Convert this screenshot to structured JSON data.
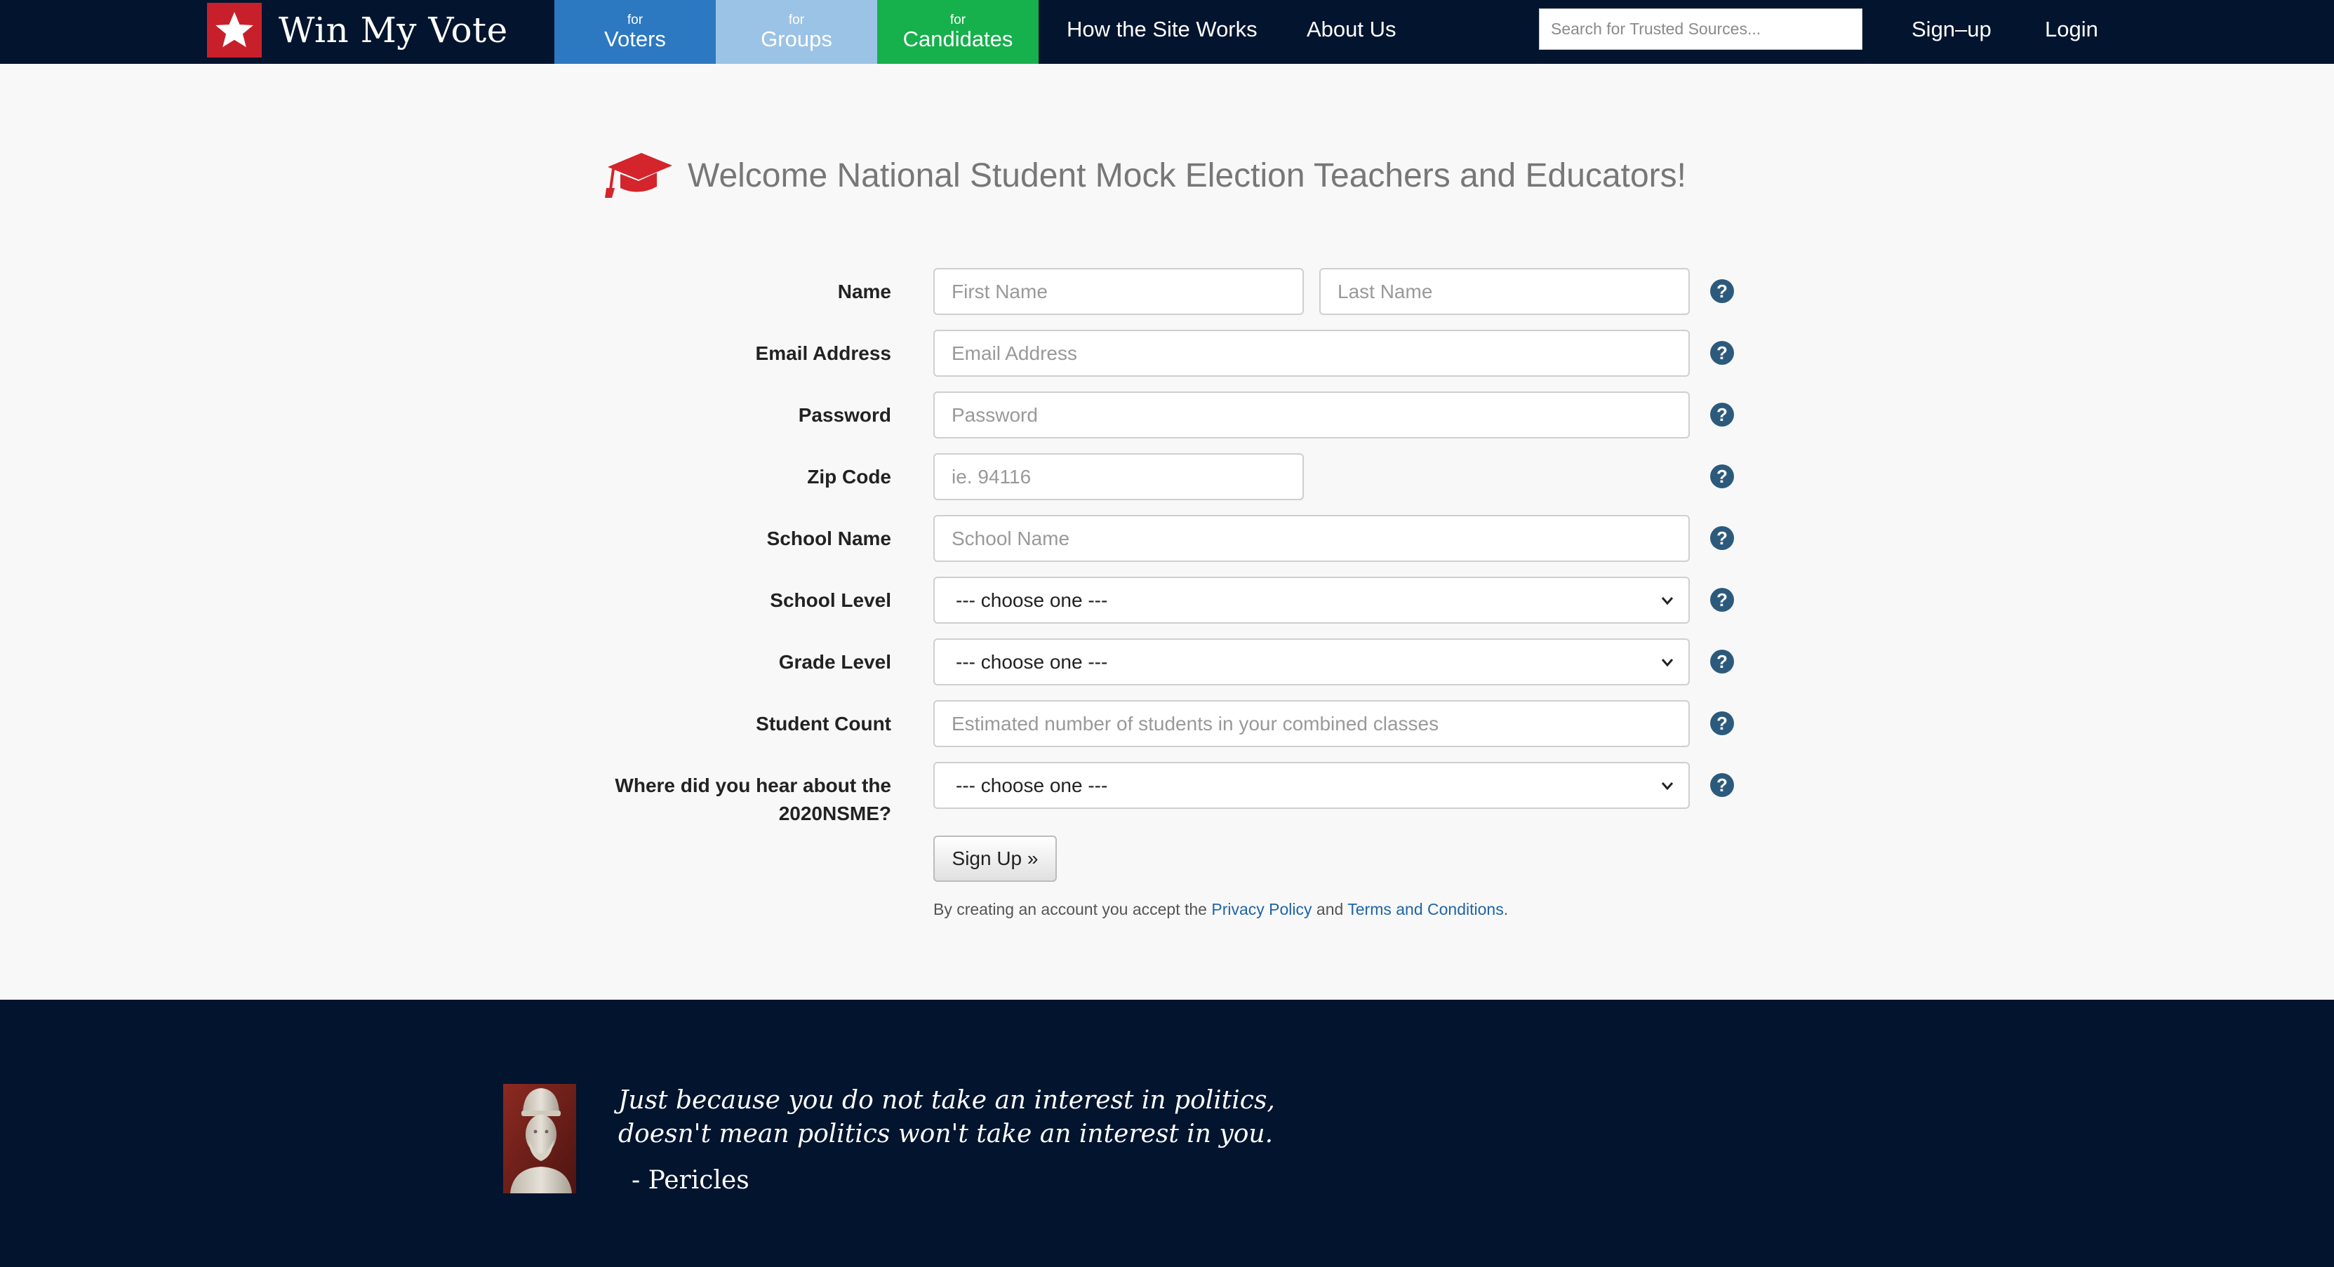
{
  "brand": {
    "name": "Win My Vote",
    "icon": "star-icon",
    "color": "#c8202b"
  },
  "nav": {
    "tabs": [
      {
        "small": "for",
        "label": "Voters",
        "color": "#2d79c1"
      },
      {
        "small": "for",
        "label": "Groups",
        "color": "#9bc3e6"
      },
      {
        "small": "for",
        "label": "Candidates",
        "color": "#16b04c"
      }
    ],
    "links": {
      "how": "How the Site Works",
      "about": "About Us",
      "signup": "Sign–up",
      "login": "Login"
    },
    "search_placeholder": "Search for Trusted Sources..."
  },
  "heading": {
    "icon": "graduation-cap-icon",
    "text": "Welcome National Student Mock Election Teachers and Educators!"
  },
  "form": {
    "name_label": "Name",
    "first_name_placeholder": "First Name",
    "last_name_placeholder": "Last Name",
    "email_label": "Email Address",
    "email_placeholder": "Email Address",
    "password_label": "Password",
    "password_placeholder": "Password",
    "zip_label": "Zip Code",
    "zip_placeholder": "ie. 94116",
    "school_name_label": "School Name",
    "school_name_placeholder": "School Name",
    "school_level_label": "School Level",
    "school_level_value": "--- choose one ---",
    "grade_level_label": "Grade Level",
    "grade_level_value": "--- choose one ---",
    "student_count_label": "Student Count",
    "student_count_placeholder": "Estimated number of students in your combined classes",
    "hear_label_line1": "Where did you hear about the",
    "hear_label_line2": "2020NSME?",
    "hear_value": "--- choose one ---",
    "help_glyph": "?",
    "submit_label": "Sign Up »"
  },
  "legal": {
    "prefix": "By creating an account you accept the",
    "privacy": "Privacy Policy",
    "and": "and",
    "terms": "Terms and Conditions",
    "suffix": "."
  },
  "footer": {
    "quote_line1": "Just because you do not take an interest in politics,",
    "quote_line2": "doesn't mean politics won't take an interest in you.",
    "author": "- Pericles",
    "image": "pericles-bust-image"
  }
}
